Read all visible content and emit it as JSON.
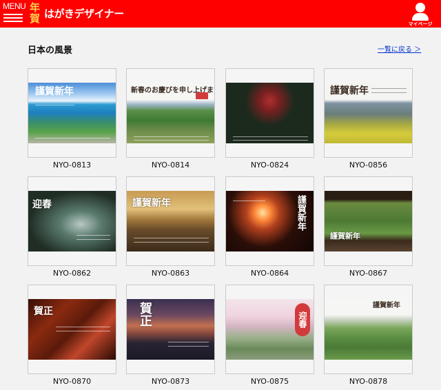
{
  "header": {
    "menu_label": "MENU",
    "logo_mark_top": "年",
    "logo_mark_bottom": "賀",
    "logo_text": "はがきデザイナー",
    "mypage_label": "マイページ"
  },
  "section": {
    "title": "日本の風景",
    "back_link": "一覧に戻る ＞"
  },
  "colors": {
    "header_bg": "#ff0000",
    "logo_gold": "#ffd24a",
    "link": "#0033cc",
    "seal_red": "#d23b3b"
  },
  "cards": [
    {
      "code": "NYO-0813",
      "greeting": "謹賀新年",
      "seal": ""
    },
    {
      "code": "NYO-0814",
      "greeting": "新春のお慶びを申し上げます",
      "seal": ""
    },
    {
      "code": "NYO-0824",
      "greeting": "",
      "seal": ""
    },
    {
      "code": "NYO-0856",
      "greeting": "謹賀新年",
      "seal": ""
    },
    {
      "code": "NYO-0862",
      "greeting": "迎春",
      "seal": ""
    },
    {
      "code": "NYO-0863",
      "greeting": "謹賀新年",
      "seal": ""
    },
    {
      "code": "NYO-0864",
      "greeting": "謹賀新年",
      "seal": ""
    },
    {
      "code": "NYO-0867",
      "greeting": "謹賀新年",
      "seal": ""
    },
    {
      "code": "NYO-0870",
      "greeting": "賀正",
      "seal": ""
    },
    {
      "code": "NYO-0873",
      "greeting": "賀正",
      "seal": ""
    },
    {
      "code": "NYO-0875",
      "greeting": "",
      "seal": "迎春"
    },
    {
      "code": "NYO-0878",
      "greeting": "謹賀新年",
      "seal": ""
    }
  ]
}
